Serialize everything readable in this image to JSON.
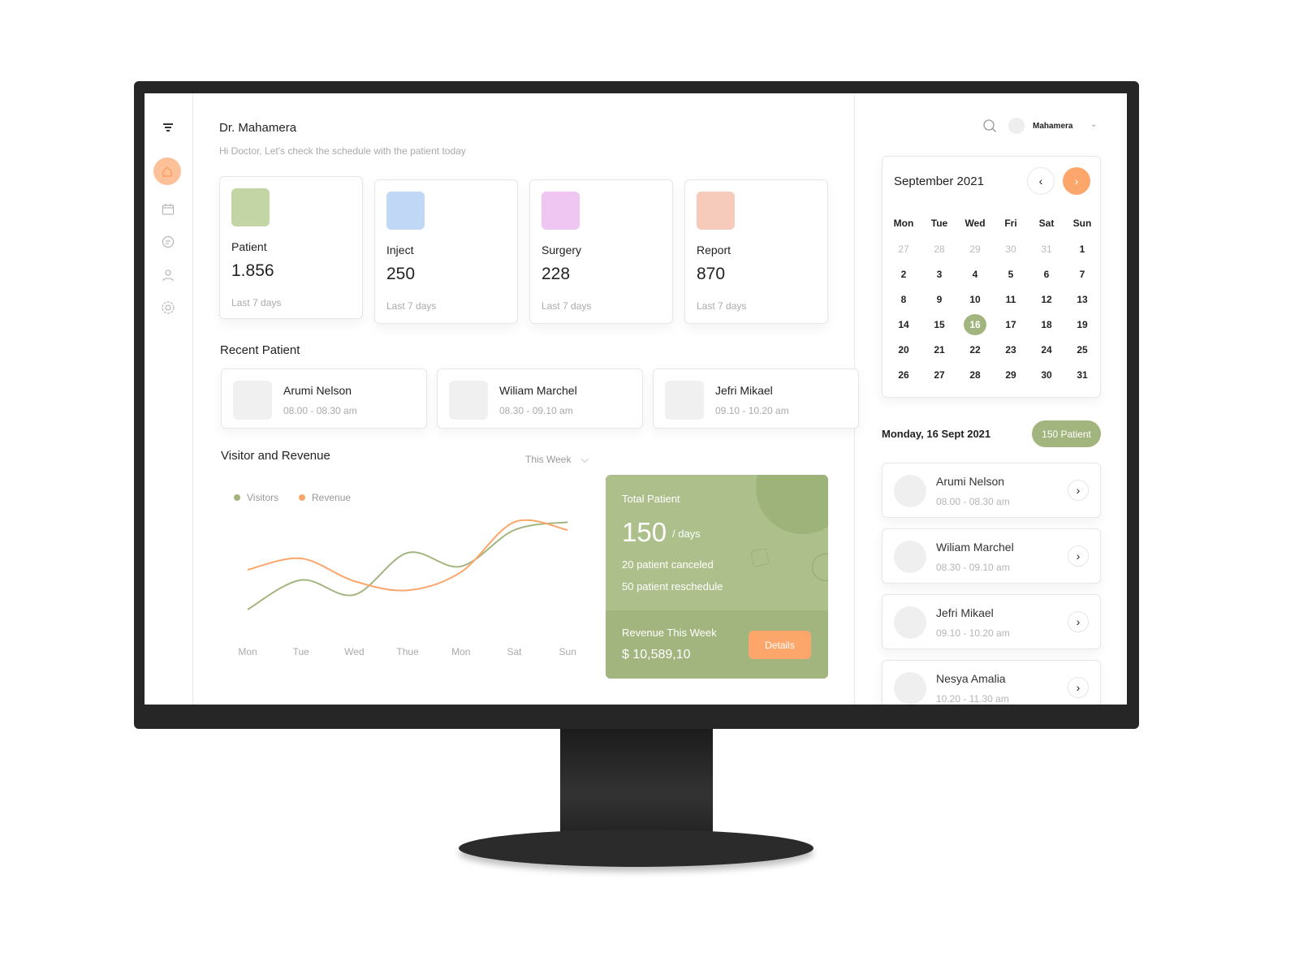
{
  "colors": {
    "accent_green": "#a3b57f",
    "accent_orange": "#fda66b",
    "patient": "#c3d4a5",
    "inject": "#c0d8f5",
    "surgery": "#efc6f2",
    "report": "#f6cbbb"
  },
  "sidebar": {
    "icons": [
      "menu-icon",
      "home-icon",
      "calendar-icon",
      "chat-icon",
      "user-icon",
      "settings-icon"
    ],
    "active": "home-icon"
  },
  "header": {
    "title": "Dr. Mahamera",
    "subtitle": "Hi Doctor, Let's check the schedule with the patient today"
  },
  "stats": [
    {
      "label": "Patient",
      "value": "1.856",
      "sub": "Last 7 days",
      "color": "#c3d4a5",
      "line": "#a9c084"
    },
    {
      "label": "Inject",
      "value": "250",
      "sub": "Last 7 days",
      "color": "#c0d8f5",
      "line": "#9cc2ef"
    },
    {
      "label": "Surgery",
      "value": "228",
      "sub": "Last 7 days",
      "color": "#efc6f2",
      "line": "#e59cec"
    },
    {
      "label": "Report",
      "value": "870",
      "sub": "Last 7 days",
      "color": "#f6cbbb",
      "line": "#f6b39a"
    }
  ],
  "recent": {
    "title": "Recent Patient",
    "items": [
      {
        "name": "Arumi Nelson",
        "time": "08.00 - 08.30 am"
      },
      {
        "name": "Wiliam Marchel",
        "time": "08.30 - 09.10 am"
      },
      {
        "name": "Jefri Mikael",
        "time": "09.10 - 10.20 am"
      }
    ]
  },
  "visitor": {
    "title": "Visitor and Revenue",
    "period": "This Week"
  },
  "chart_data": {
    "type": "line",
    "categories": [
      "Mon",
      "Tue",
      "Wed",
      "Thue",
      "Mon",
      "Sat",
      "Sun"
    ],
    "series": [
      {
        "name": "Visitors",
        "color": "#a3b57f",
        "values": [
          10,
          36,
          23,
          60,
          48,
          80,
          87
        ]
      },
      {
        "name": "Revenue",
        "color": "#fda66b",
        "values": [
          45,
          55,
          35,
          27,
          43,
          87,
          80
        ]
      }
    ],
    "ylim": [
      0,
      100
    ],
    "grid": false,
    "legend": "top-left"
  },
  "total": {
    "title": "Total Patient",
    "value": "150",
    "unit": "/ days",
    "canceled": "20 patient canceled",
    "reschedule": "50 patient reschedule",
    "revenue_label": "Revenue This Week",
    "revenue": "$ 10,589,10",
    "details": "Details"
  },
  "topbar": {
    "user": "Mahamera"
  },
  "calendar": {
    "month": "September 2021",
    "days": [
      "Mon",
      "Tue",
      "Wed",
      "Fri",
      "Sat",
      "Sun"
    ],
    "weeks": [
      [
        "27",
        "28",
        "29",
        "30",
        "31",
        "1"
      ],
      [
        "2",
        "3",
        "4",
        "5",
        "6",
        "7"
      ],
      [
        "8",
        "9",
        "10",
        "11",
        "12",
        "13"
      ],
      [
        "14",
        "15",
        "16",
        "17",
        "18",
        "19"
      ],
      [
        "20",
        "21",
        "22",
        "23",
        "24",
        "25"
      ],
      [
        "26",
        "27",
        "28",
        "29",
        "30",
        "31"
      ]
    ],
    "selected": "16"
  },
  "schedule": {
    "date": "Monday, 16 Sept 2021",
    "badge": "150 Patient",
    "items": [
      {
        "name": "Arumi Nelson",
        "time": "08.00 - 08.30 am"
      },
      {
        "name": "Wiliam Marchel",
        "time": "08.30 - 09.10 am"
      },
      {
        "name": "Jefri Mikael",
        "time": "09.10 - 10.20 am"
      },
      {
        "name": "Nesya Amalia",
        "time": "10.20 - 11.30 am"
      }
    ]
  }
}
